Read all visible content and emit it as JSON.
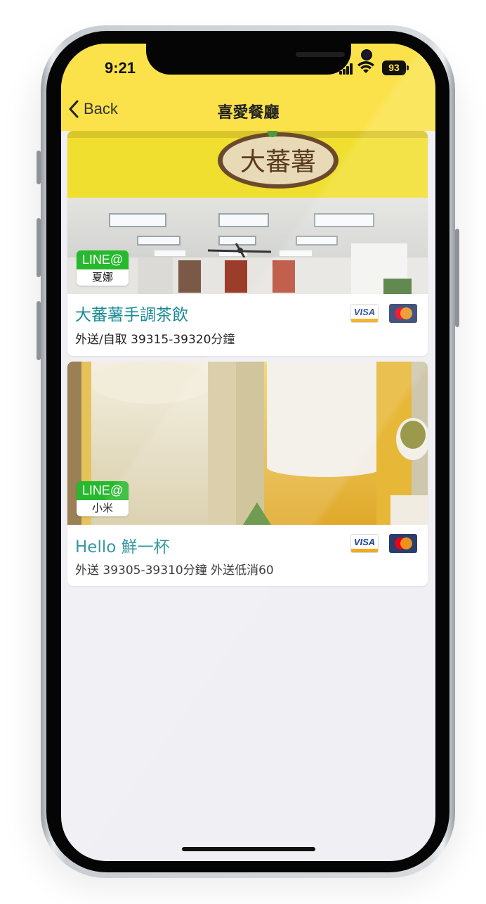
{
  "status_bar": {
    "time": "9:21",
    "battery": "93"
  },
  "nav": {
    "back_label": "Back",
    "title": "喜愛餐廳"
  },
  "restaurants": [
    {
      "name": "大蕃薯手調茶飲",
      "info": "外送/自取 39315-39320分鐘",
      "line_badge": "LINE@",
      "line_name": "夏娜",
      "sign_text": "大蕃薯",
      "payments": [
        "VISA",
        "mastercard"
      ]
    },
    {
      "name": "Hello 鮮一杯",
      "info": "外送 39305-39310分鐘 外送低消60",
      "line_badge": "LINE@",
      "line_name": "小米",
      "payments": [
        "VISA",
        "mastercard"
      ]
    }
  ],
  "colors": {
    "header_yellow": "#fbe24a",
    "name_teal": "#1a8b95",
    "line_green": "#27b92d",
    "background": "#efeff4"
  }
}
